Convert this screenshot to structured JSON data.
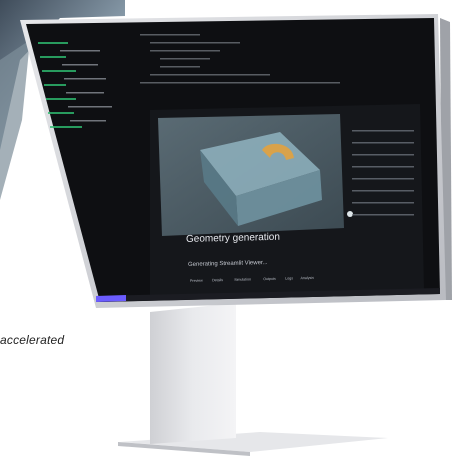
{
  "caption": "accelerated",
  "screen": {
    "viewer": {
      "title": "Geometry generation",
      "subtitle": "Generating Streamlit Viewer...",
      "tabs": [
        "Preview",
        "Details",
        "Simulation",
        "Outputs",
        "Logs",
        "Analysis"
      ]
    }
  },
  "colors": {
    "bezel": "#d7d8dc",
    "screen_bg": "#0e0f12",
    "accent": "#6b5cff",
    "viewport": "#6e8790"
  },
  "icons": [
    "close-icon",
    "chevron-down-icon"
  ]
}
